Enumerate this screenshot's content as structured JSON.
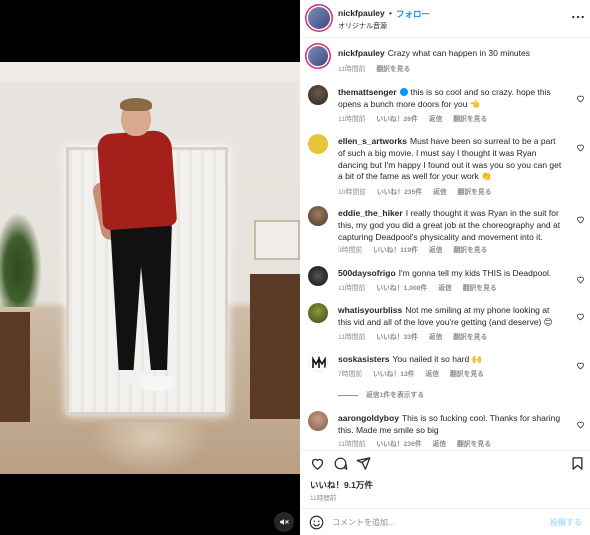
{
  "header": {
    "username": "nickfpauley",
    "separator": "•",
    "follow_label": "フォロー",
    "audio_label": "オリジナル音源"
  },
  "caption": {
    "username": "nickfpauley",
    "text": "Crazy what can happen in 30 minutes",
    "time": "11時間前",
    "translate": "翻訳を見る"
  },
  "comments": [
    {
      "username": "themattsenger",
      "verified": true,
      "text": "this is so cool and so crazy. hope this opens a bunch more doors for you 👈",
      "time": "11時間前",
      "likes": "いいね！26件",
      "reply": "返信",
      "translate": "翻訳を見る"
    },
    {
      "username": "ellen_s_artworks",
      "text": "Must have been so surreal to be a part of such a big movie. I must say I thought it was Ryan dancing but I'm happy I found out it was you so you can get a bit of the fame as well for your work 👏",
      "time": "10時間前",
      "likes": "いいね！235件",
      "reply": "返信",
      "translate": "翻訳を見る"
    },
    {
      "username": "eddie_the_hiker",
      "text": "I really thought it was Ryan in the suit for this, my god you did a great job at the choreography and at capturing Deadpool's physicality and movement into it.",
      "time": "3時間前",
      "likes": "いいね！119件",
      "reply": "返信",
      "translate": "翻訳を見る"
    },
    {
      "username": "500daysofrigo",
      "text": "I'm gonna tell my kids THIS is Deadpool.",
      "time": "11時間前",
      "likes": "いいね！1,008件",
      "reply": "返信",
      "translate": "翻訳を見る"
    },
    {
      "username": "whatisyourbliss",
      "text": "Not me smiling at my phone looking at this vid and all of the love you're getting (and deserve) 😊",
      "time": "11時間前",
      "likes": "いいね！33件",
      "reply": "返信",
      "translate": "翻訳を見る"
    },
    {
      "username": "soskasisters",
      "text": "You nailed it so hard 🙌",
      "time": "7時間前",
      "likes": "いいね！13件",
      "reply": "返信",
      "translate": "翻訳を見る",
      "view_replies": "返信1件を表示する"
    },
    {
      "username": "aarongoldyboy",
      "text": "This is so fucking cool. Thanks for sharing this. Made me smile so big",
      "time": "11時間前",
      "likes": "いいね！236件",
      "reply": "返信",
      "translate": "翻訳を見る"
    }
  ],
  "footer": {
    "likes": "いいね！9.1万件",
    "time": "11時間前"
  },
  "comment_box": {
    "placeholder": "コメントを追加...",
    "post_label": "投稿する"
  },
  "icons": [
    "more-icon",
    "verified-icon",
    "heart-icon",
    "comment-icon",
    "share-icon",
    "bookmark-icon",
    "emoji-icon",
    "mute-icon"
  ],
  "colors": {
    "link": "#0095f6",
    "muted": "#8e8e8e",
    "text": "#262626"
  }
}
